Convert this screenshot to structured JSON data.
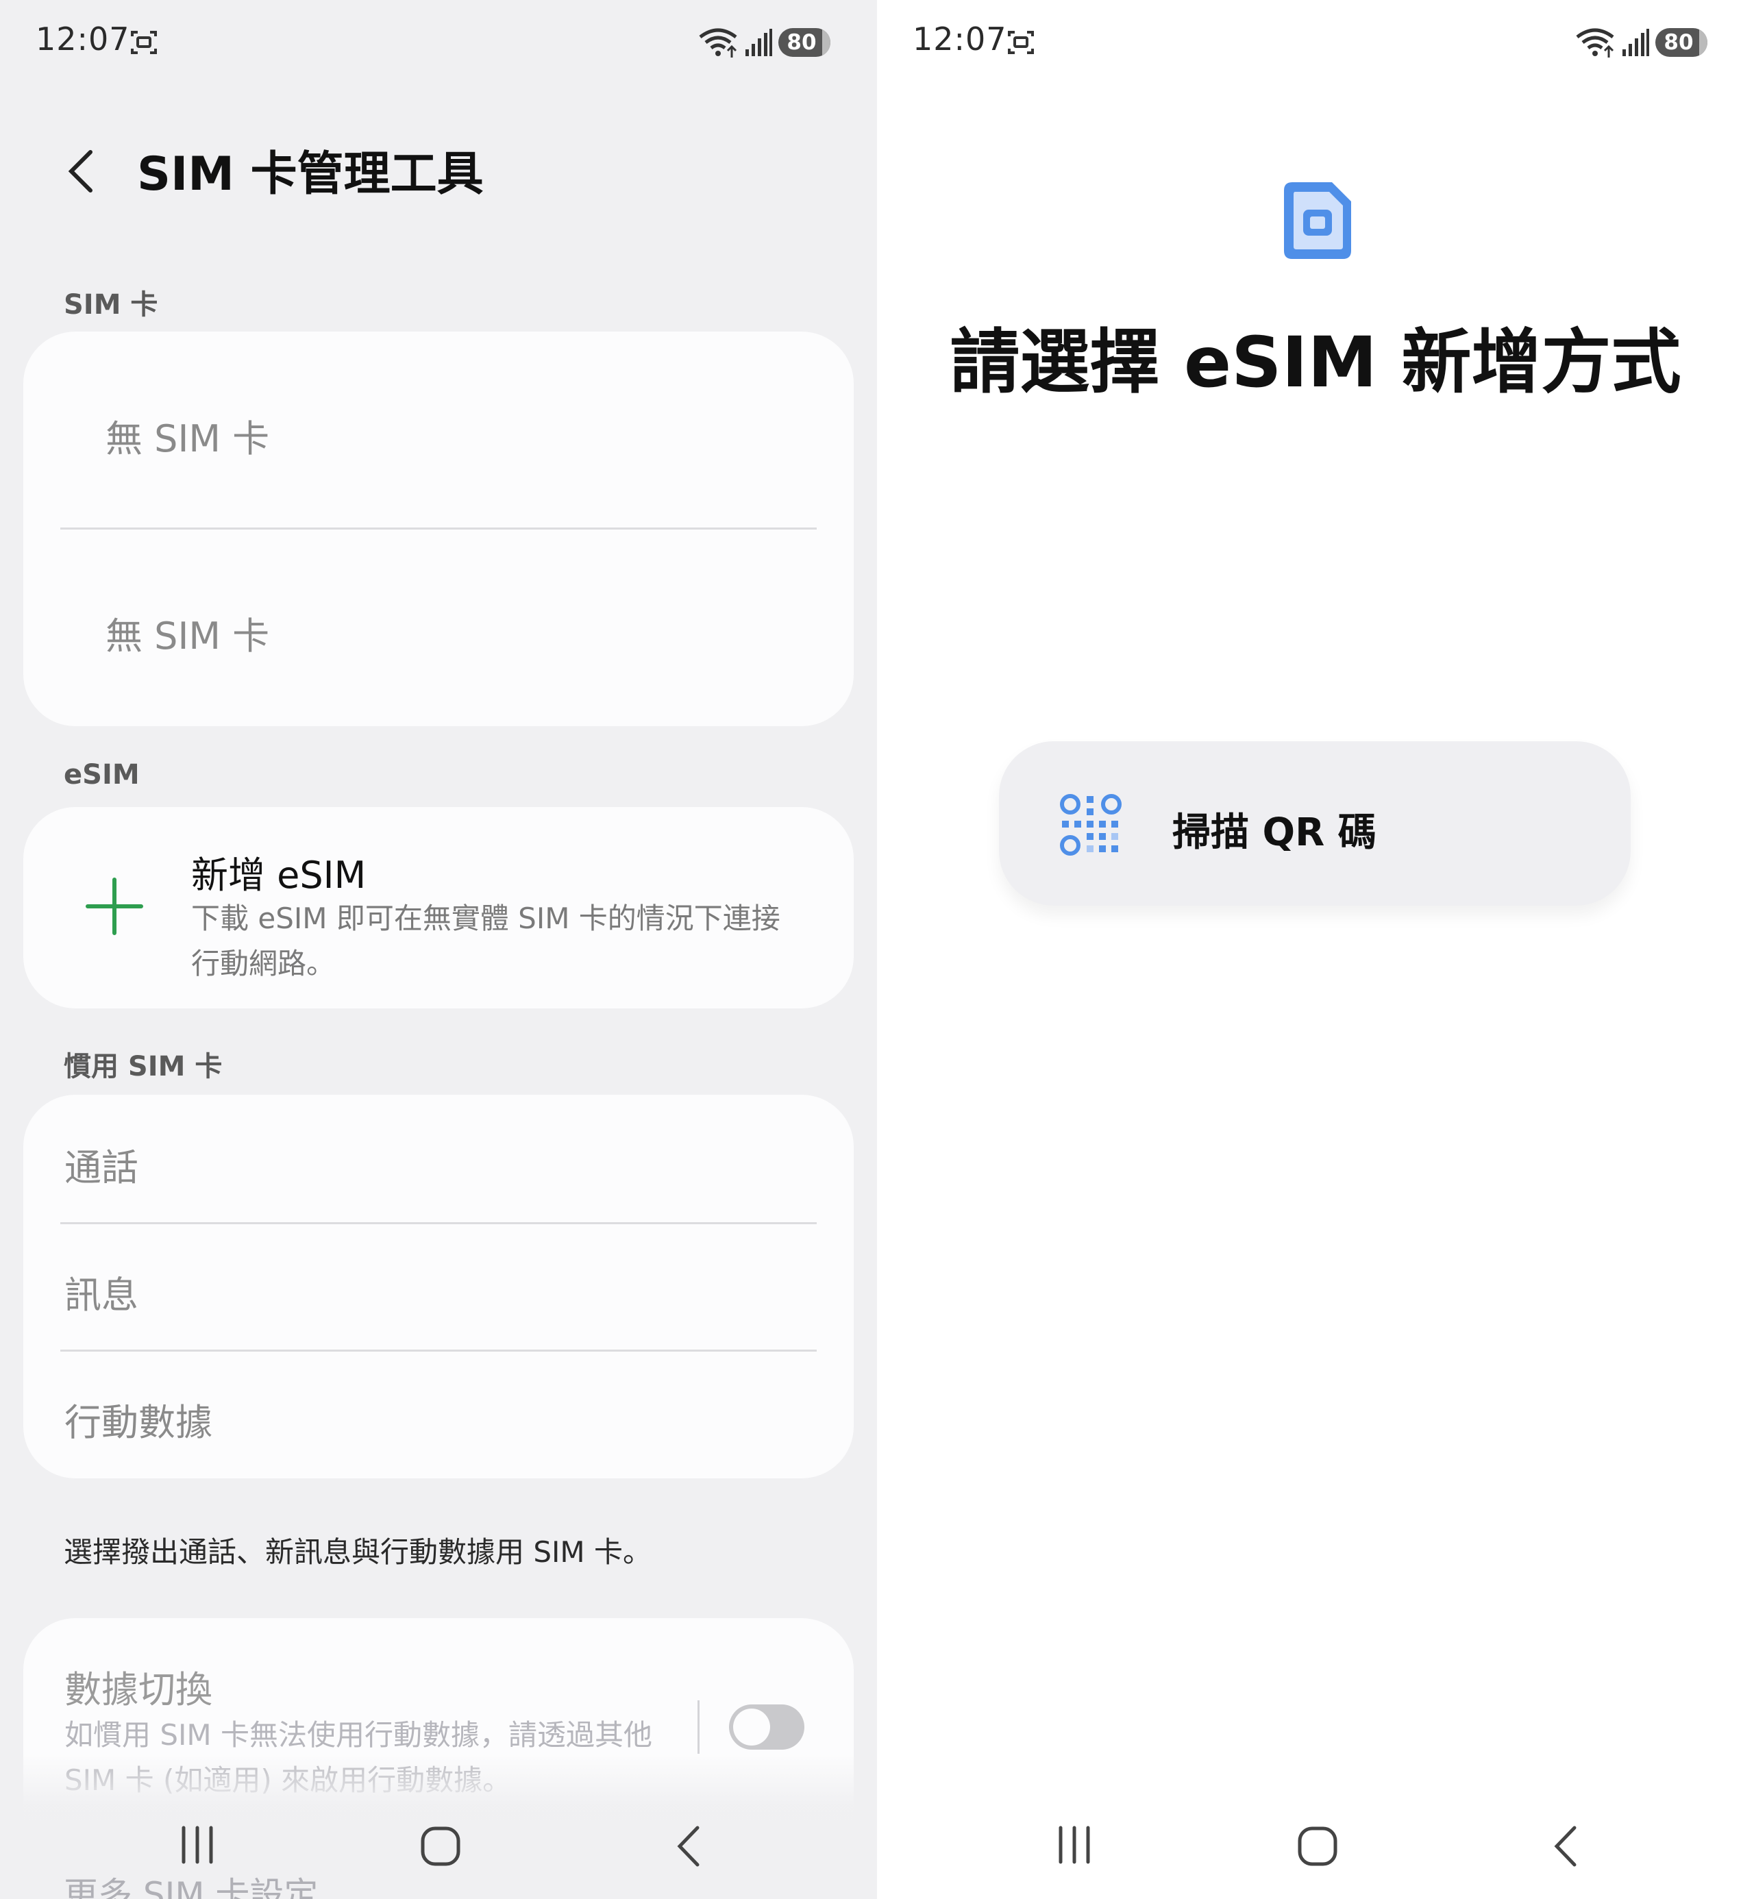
{
  "status": {
    "time": "12:07",
    "battery": "80"
  },
  "left": {
    "title": "SIM 卡管理工具",
    "sim_section": {
      "label": "SIM 卡",
      "slots": [
        {
          "label": "無 SIM 卡"
        },
        {
          "label": "無 SIM 卡"
        }
      ]
    },
    "esim_section": {
      "label": "eSIM",
      "add_title": "新增 eSIM",
      "add_desc": "下載 eSIM 即可在無實體 SIM 卡的情況下連接行動網路。"
    },
    "preferred_section": {
      "label": "慣用 SIM 卡",
      "items": [
        {
          "label": "通話"
        },
        {
          "label": "訊息"
        },
        {
          "label": "行動數據"
        }
      ],
      "footnote": "選擇撥出通話、新訊息與行動數據用 SIM 卡。"
    },
    "data_switching": {
      "title": "數據切換",
      "desc": "如慣用 SIM 卡無法使用行動數據，請透過其他 SIM 卡 (如適用) 來啟用行動數據。",
      "enabled": false
    },
    "next_item": "更多 SIM 卡設定"
  },
  "right": {
    "heading": "請選擇 eSIM 新增方式",
    "scan_button": "掃描 QR 碼"
  },
  "colors": {
    "accent_green": "#2e9e4f",
    "accent_blue": "#4f8fe8",
    "page_bg": "#f0f0f2"
  },
  "icons": [
    "cast-icon",
    "wifi-icon",
    "signal-icon",
    "back-arrow-icon",
    "plus-icon",
    "sim-card-icon",
    "qr-code-icon",
    "recent-apps-icon",
    "home-icon",
    "nav-back-icon"
  ]
}
